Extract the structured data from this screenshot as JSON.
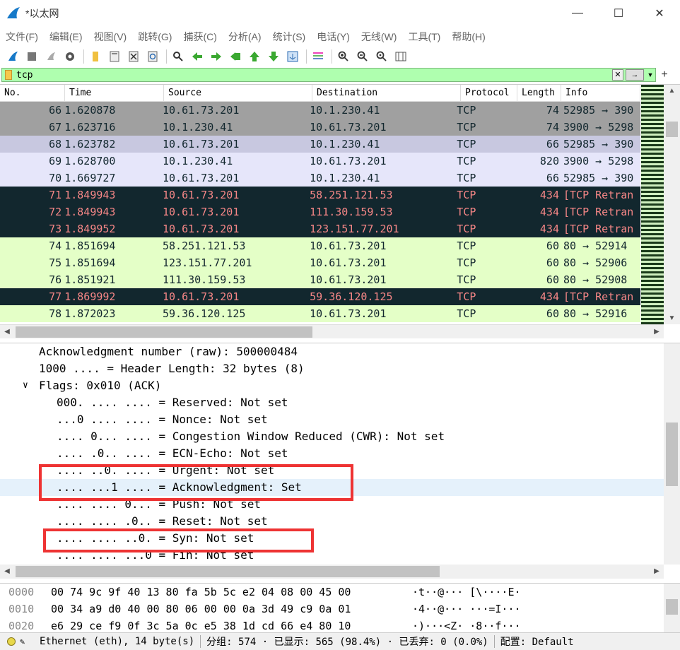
{
  "window": {
    "title": "*以太网",
    "controls": [
      "minimize-icon",
      "maximize-icon",
      "close-icon"
    ]
  },
  "menu": [
    "文件(F)",
    "编辑(E)",
    "视图(V)",
    "跳转(G)",
    "捕获(C)",
    "分析(A)",
    "统计(S)",
    "电话(Y)",
    "无线(W)",
    "工具(T)",
    "帮助(H)"
  ],
  "toolbar_icons": [
    "start-capture-icon",
    "stop-capture-icon",
    "restart-capture-icon",
    "capture-options-icon",
    "open-file-icon",
    "save-file-icon",
    "close-file-icon",
    "reload-file-icon",
    "find-packet-icon",
    "go-back-icon",
    "go-forward-icon",
    "go-to-packet-icon",
    "first-packet-icon",
    "last-packet-icon",
    "auto-scroll-icon",
    "colorize-icon",
    "zoom-in-icon",
    "zoom-out-icon",
    "normal-size-icon",
    "resize-columns-icon"
  ],
  "filter": {
    "value": "tcp",
    "apply_label": "→",
    "add_label": "+"
  },
  "columns": [
    "No.",
    "Time",
    "Source",
    "Destination",
    "Protocol",
    "Length",
    "Info"
  ],
  "packets": [
    {
      "no": "66",
      "time": "1.620878",
      "src": "10.61.73.201",
      "dst": "10.1.230.41",
      "proto": "TCP",
      "len": "74",
      "info": "52985 → 390"
    },
    {
      "no": "67",
      "time": "1.623716",
      "src": "10.1.230.41",
      "dst": "10.61.73.201",
      "proto": "TCP",
      "len": "74",
      "info": "3900 → 5298"
    },
    {
      "no": "68",
      "time": "1.623782",
      "src": "10.61.73.201",
      "dst": "10.1.230.41",
      "proto": "TCP",
      "len": "66",
      "info": "52985 → 390"
    },
    {
      "no": "69",
      "time": "1.628700",
      "src": "10.1.230.41",
      "dst": "10.61.73.201",
      "proto": "TCP",
      "len": "820",
      "info": "3900 → 5298"
    },
    {
      "no": "70",
      "time": "1.669727",
      "src": "10.61.73.201",
      "dst": "10.1.230.41",
      "proto": "TCP",
      "len": "66",
      "info": "52985 → 390"
    },
    {
      "no": "71",
      "time": "1.849943",
      "src": "10.61.73.201",
      "dst": "58.251.121.53",
      "proto": "TCP",
      "len": "434",
      "info": "[TCP Retran"
    },
    {
      "no": "72",
      "time": "1.849943",
      "src": "10.61.73.201",
      "dst": "111.30.159.53",
      "proto": "TCP",
      "len": "434",
      "info": "[TCP Retran"
    },
    {
      "no": "73",
      "time": "1.849952",
      "src": "10.61.73.201",
      "dst": "123.151.77.201",
      "proto": "TCP",
      "len": "434",
      "info": "[TCP Retran"
    },
    {
      "no": "74",
      "time": "1.851694",
      "src": "58.251.121.53",
      "dst": "10.61.73.201",
      "proto": "TCP",
      "len": "60",
      "info": "80 → 52914"
    },
    {
      "no": "75",
      "time": "1.851694",
      "src": "123.151.77.201",
      "dst": "10.61.73.201",
      "proto": "TCP",
      "len": "60",
      "info": "80 → 52906"
    },
    {
      "no": "76",
      "time": "1.851921",
      "src": "111.30.159.53",
      "dst": "10.61.73.201",
      "proto": "TCP",
      "len": "60",
      "info": "80 → 52908"
    },
    {
      "no": "77",
      "time": "1.869992",
      "src": "10.61.73.201",
      "dst": "59.36.120.125",
      "proto": "TCP",
      "len": "434",
      "info": "[TCP Retran"
    },
    {
      "no": "78",
      "time": "1.872023",
      "src": "59.36.120.125",
      "dst": "10.61.73.201",
      "proto": "TCP",
      "len": "60",
      "info": "80 → 52916"
    }
  ],
  "row_colors": [
    "#a0a0a0",
    "#a0a0a0",
    "#c8c8e0",
    "#e6e6fa",
    "#e6e6fa",
    "#12272e",
    "#12272e",
    "#12272e",
    "#e4ffc7",
    "#e4ffc7",
    "#e4ffc7",
    "#12272e",
    "#e4ffc7"
  ],
  "row_text_colors": [
    "#12272e",
    "#12272e",
    "#12272e",
    "#12272e",
    "#12272e",
    "#f78787",
    "#f78787",
    "#f78787",
    "#12272e",
    "#12272e",
    "#12272e",
    "#f78787",
    "#12272e"
  ],
  "details": [
    {
      "text": "Acknowledgment number (raw): 500000484",
      "indent": 0
    },
    {
      "text": "1000 .... = Header Length: 32 bytes (8)",
      "indent": 0
    },
    {
      "text": "Flags: 0x010 (ACK)",
      "indent": 0,
      "expander": "∨"
    },
    {
      "text": "000. .... .... = Reserved: Not set",
      "indent": 1
    },
    {
      "text": "...0 .... .... = Nonce: Not set",
      "indent": 1
    },
    {
      "text": ".... 0... .... = Congestion Window Reduced (CWR): Not set",
      "indent": 1
    },
    {
      "text": ".... .0.. .... = ECN-Echo: Not set",
      "indent": 1
    },
    {
      "text": ".... ..0. .... = Urgent: Not set",
      "indent": 1
    },
    {
      "text": ".... ...1 .... = Acknowledgment: Set",
      "indent": 1,
      "selected": true
    },
    {
      "text": ".... .... 0... = Push: Not set",
      "indent": 1
    },
    {
      "text": ".... .... .0.. = Reset: Not set",
      "indent": 1
    },
    {
      "text": ".... .... ..0. = Syn: Not set",
      "indent": 1
    },
    {
      "text": ".... .... ...0 = Fin: Not set",
      "indent": 1
    }
  ],
  "bytes": [
    {
      "offset": "0000",
      "hex": "00 74 9c 9f 40 13 80 fa  5b 5c e2 04 08 00 45 00",
      "ascii": "·t··@···  [\\····E·"
    },
    {
      "offset": "0010",
      "hex": "00 34 a9 d0 40 00 80 06  00 00 0a 3d 49 c9 0a 01",
      "ascii": "·4··@···  ···=I···"
    },
    {
      "offset": "0020",
      "hex": "e6 29 ce f9 0f 3c 5a 0c  e5 38 1d cd 66 e4 80 10",
      "ascii": "·)···<Z·  ·8··f···"
    }
  ],
  "status": {
    "interface": "Ethernet (eth), 14 byte(s)",
    "packets": "分组: 574 · 已显示: 565 (98.4%) · 已丢弃: 0 (0.0%)",
    "profile": "配置: Default"
  }
}
